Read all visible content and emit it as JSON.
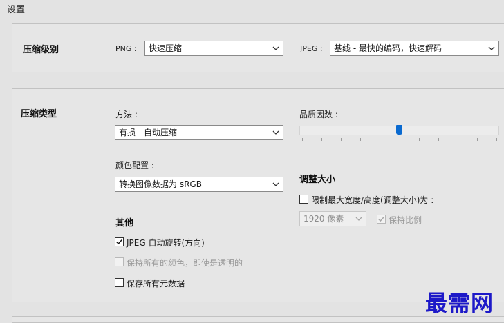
{
  "legend": "设置",
  "compression_level": {
    "title": "压缩级别",
    "png_label": "PNG :",
    "png_value": "快速压缩",
    "jpeg_label": "JPEG :",
    "jpeg_value": "基线 - 最快的编码，快速解码"
  },
  "compression_type": {
    "title": "压缩类型",
    "method_label": "方法 :",
    "method_value": "有损 - 自动压缩",
    "quality_label": "品质因数 :",
    "quality_level": 0.5,
    "color_profile_label": "颜色配置 :",
    "color_profile_value": "转换图像数据为 sRGB",
    "resize_title": "调整大小",
    "limit_label": "限制最大宽度/高度(调整大小)为 :",
    "limit_checked": false,
    "size_value": "1920 像素",
    "keep_ratio_label": "保持比例",
    "keep_ratio_checked": true,
    "other_title": "其他",
    "auto_rotate_label": "JPEG 自动旋转(方向)",
    "auto_rotate_checked": true,
    "keep_colors_label": "保持所有的颜色，即使是透明的",
    "keep_colors_checked": false,
    "keep_metadata_label": "保存所有元数据",
    "keep_metadata_checked": false
  },
  "watermark": "最需网",
  "colors": {
    "slider_thumb": "#0a6ad0",
    "watermark": "#1d19c8"
  }
}
